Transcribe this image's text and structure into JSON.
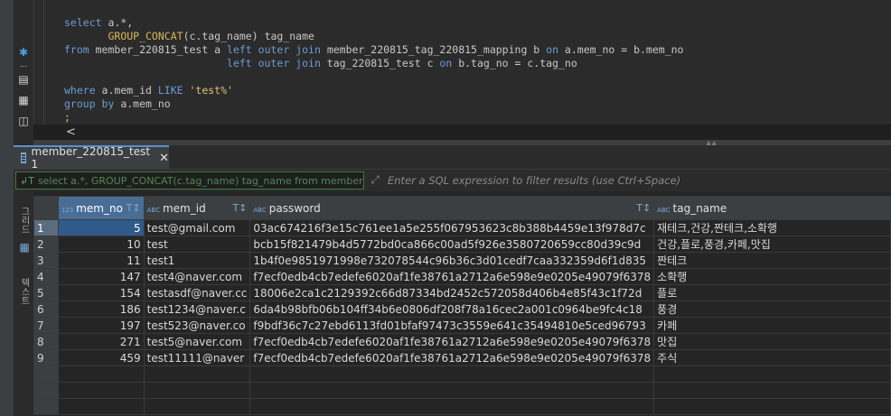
{
  "editor": {
    "lines": [
      {
        "parts": [
          [
            "kw",
            "select "
          ],
          [
            "id",
            "a.*,"
          ]
        ]
      },
      {
        "parts": [
          [
            "id",
            "       "
          ],
          [
            "fn",
            "GROUP_CONCAT"
          ],
          [
            "id",
            "(c.tag_name) tag_name"
          ]
        ]
      },
      {
        "parts": [
          [
            "kw",
            "from "
          ],
          [
            "id",
            "member_220815_test a "
          ],
          [
            "kw",
            "left outer join "
          ],
          [
            "id",
            "member_220815_tag_220815_mapping b "
          ],
          [
            "kw",
            "on "
          ],
          [
            "id",
            "a.mem_no = b.mem_no"
          ]
        ]
      },
      {
        "parts": [
          [
            "id",
            "                          "
          ],
          [
            "kw",
            "left outer join "
          ],
          [
            "id",
            "tag_220815_test c "
          ],
          [
            "kw",
            "on "
          ],
          [
            "id",
            "b.tag_no = c.tag_no"
          ]
        ]
      },
      {
        "parts": [
          [
            "id",
            ""
          ]
        ]
      },
      {
        "parts": [
          [
            "kw",
            "where "
          ],
          [
            "id",
            "a.mem_id "
          ],
          [
            "kw",
            "LIKE "
          ],
          [
            "str",
            "'test%'"
          ]
        ]
      },
      {
        "parts": [
          [
            "kw",
            "group by "
          ],
          [
            "id",
            "a.mem_no"
          ]
        ]
      },
      {
        "parts": [
          [
            "semi",
            ";"
          ]
        ]
      }
    ]
  },
  "result_tab": {
    "label": "member_220815_test 1",
    "close": "✕"
  },
  "filter": {
    "value": "select a.*, GROUP_CONCAT(c.tag_name) tag_name from member_",
    "placeholder": "Enter a SQL expression to filter results (use Ctrl+Space)"
  },
  "side_tabs": {
    "grid": "그리드",
    "text": "텍스트"
  },
  "table": {
    "columns": [
      {
        "name": "mem_no",
        "type": "123"
      },
      {
        "name": "mem_id",
        "type": "ABC"
      },
      {
        "name": "password",
        "type": "ABC"
      },
      {
        "name": "tag_name",
        "type": "ABC"
      }
    ],
    "rows": [
      {
        "n": "1",
        "mem_no": "5",
        "mem_id": "test@gmail.com",
        "password": "03ac674216f3e15c761ee1a5e255f067953623c8b388b4459e13f978d7c",
        "tag_name": "재테크,건강,짠테크,소확행"
      },
      {
        "n": "2",
        "mem_no": "10",
        "mem_id": "test",
        "password": "bcb15f821479b4d5772bd0ca866c00ad5f926e3580720659cc80d39c9d",
        "tag_name": "건강,플로,풍경,카페,맛집"
      },
      {
        "n": "3",
        "mem_no": "11",
        "mem_id": "test1",
        "password": "1b4f0e9851971998e732078544c96b36c3d01cedf7caa332359d6f1d835",
        "tag_name": "짠테크"
      },
      {
        "n": "4",
        "mem_no": "147",
        "mem_id": "test4@naver.com",
        "password": "f7ecf0edb4cb7edefe6020af1fe38761a2712a6e598e9e0205e49079f6378",
        "tag_name": "소확행"
      },
      {
        "n": "5",
        "mem_no": "154",
        "mem_id": "testasdf@naver.cc",
        "password": "18006e2ca1c2129392c66d87334bd2452c572058d406b4e85f43c1f72d",
        "tag_name": "플로"
      },
      {
        "n": "6",
        "mem_no": "186",
        "mem_id": "test1234@naver.c",
        "password": "6da4b98bfb06b104ff34b6e0806df208f78a16cec2a001c0964be9fc4c18",
        "tag_name": "풍경"
      },
      {
        "n": "7",
        "mem_no": "197",
        "mem_id": "test523@naver.co",
        "password": "f9bdf36c7c27ebd6113fd01bfaf97473c3559e641c35494810e5ced96793",
        "tag_name": "카페"
      },
      {
        "n": "8",
        "mem_no": "271",
        "mem_id": "test5@naver.com",
        "password": "f7ecf0edb4cb7edefe6020af1fe38761a2712a6e598e9e0205e49079f6378",
        "tag_name": "맛집"
      },
      {
        "n": "9",
        "mem_no": "459",
        "mem_id": "test11111@naver",
        "password": "f7ecf0edb4cb7edefe6020af1fe38761a2712a6e598e9e0205e49079f6378",
        "tag_name": "주식"
      }
    ]
  }
}
